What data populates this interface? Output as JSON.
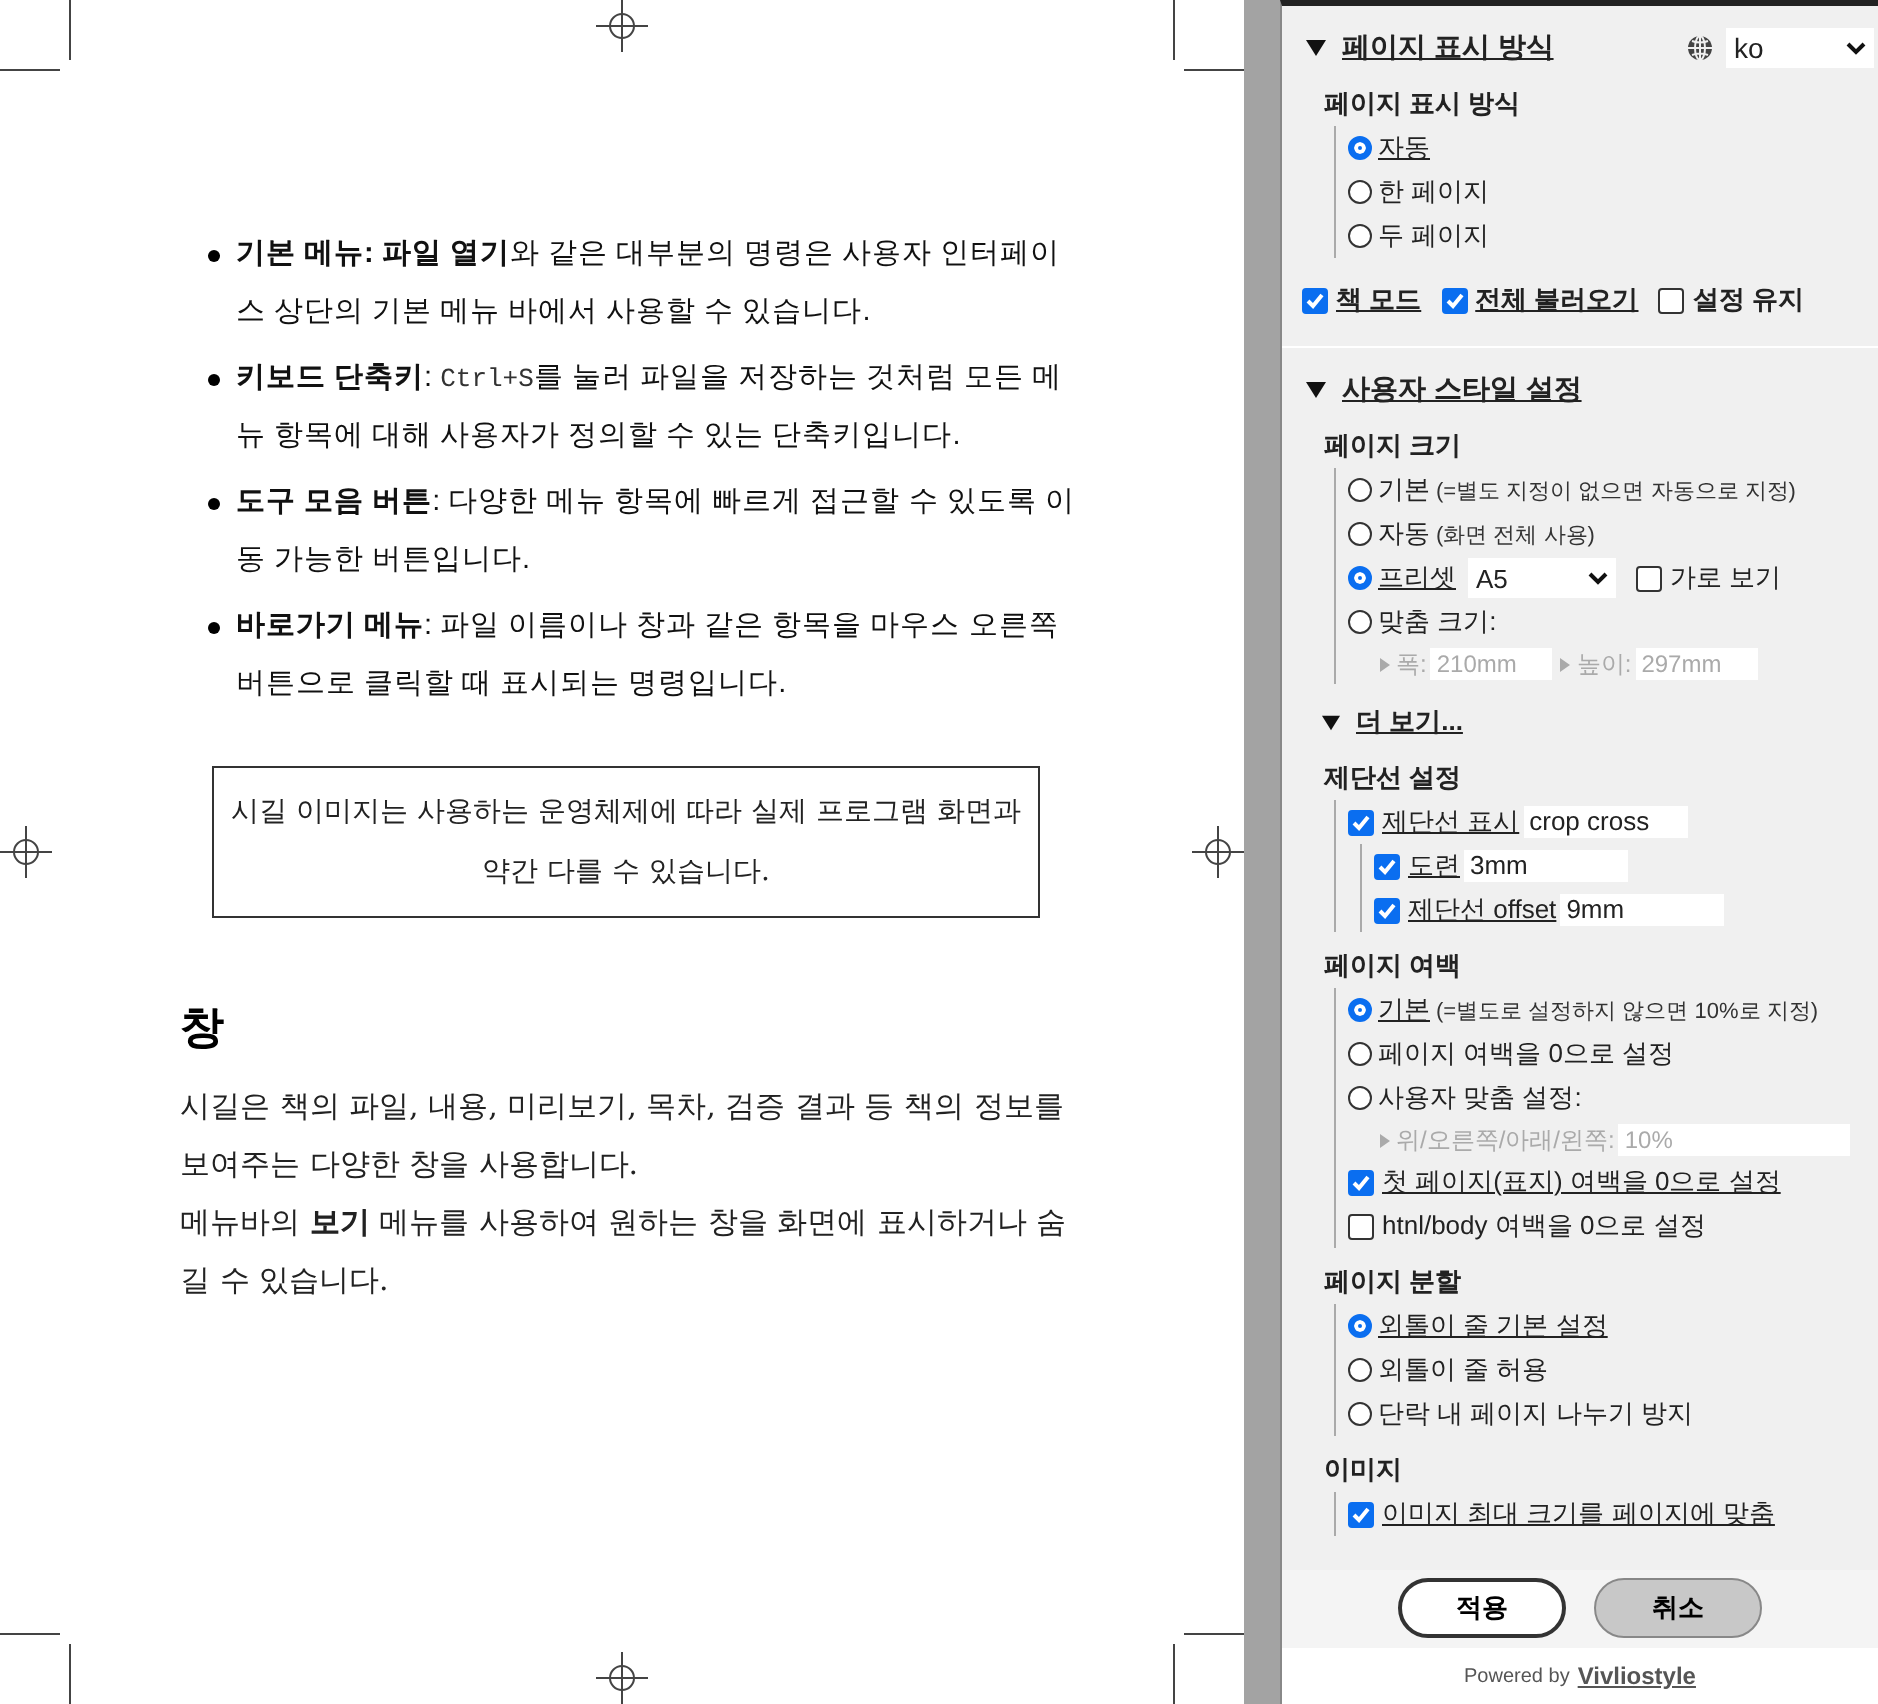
{
  "document": {
    "bullets": [
      {
        "segments": [
          {
            "kind": "bold",
            "text": "기본 메뉴: 파일  열기"
          },
          {
            "kind": "plain",
            "text": "와 같은 대부분의 명령은 사용자 인터페이스 상단의 기본 메뉴 바에서 사용할 수 있습니다."
          }
        ]
      },
      {
        "segments": [
          {
            "kind": "bold",
            "text": "키보드 단축키"
          },
          {
            "kind": "plain",
            "text": ": "
          },
          {
            "kind": "code",
            "text": "Ctrl+S"
          },
          {
            "kind": "plain",
            "text": "를 눌러 파일을 저장하는 것처럼 모든 메뉴 항목에 대해 사용자가 정의할 수 있는 단축키입니다."
          }
        ]
      },
      {
        "segments": [
          {
            "kind": "bold",
            "text": "도구 모음 버튼"
          },
          {
            "kind": "plain",
            "text": ": 다양한 메뉴 항목에 빠르게 접근할 수 있도록 이동 가능한 버튼입니다."
          }
        ]
      },
      {
        "segments": [
          {
            "kind": "bold",
            "text": "바로가기 메뉴"
          },
          {
            "kind": "plain",
            "text": ": 파일 이름이나 창과 같은 항목을 마우스 오른쪽 버튼으로 클릭할 때 표시되는 명령입니다."
          }
        ]
      }
    ],
    "note": "시길 이미지는 사용하는 운영체제에 따라 실제 프로그램 화면과 약간 다를 수 있습니다.",
    "heading": "창",
    "paragraphs": [
      "시길은 책의 파일, 내용, 미리보기, 목차, 검증 결과 등 책의 정보를 보여주는 다양한 창을 사용합니다.",
      "메뉴바의 **보기** 메뉴를 사용하여 원하는 창을 화면에 표시하거나 숨길 수 있습니다."
    ]
  },
  "sidebar": {
    "sections": [
      {
        "title": "페이지 표시 방식",
        "expanded": true,
        "language": "ko",
        "groups": [
          {
            "title": "페이지 표시 방식",
            "items": [
              {
                "kind": "radio",
                "label": "자동",
                "selected": true
              },
              {
                "kind": "radio",
                "label": "한 페이지",
                "selected": false
              },
              {
                "kind": "radio",
                "label": "두 페이지",
                "selected": false
              }
            ]
          }
        ],
        "options_row": [
          {
            "label": "책 모드",
            "checked": true
          },
          {
            "label": "전체 불러오기",
            "checked": true
          },
          {
            "label": "설정 유지",
            "checked": false
          }
        ]
      },
      {
        "title": "사용자 스타일 설정",
        "expanded": true,
        "groups": [
          {
            "title": "페이지 크기",
            "items": [
              {
                "kind": "radio",
                "label": "기본",
                "hint": "(=별도 지정이 없으면 자동으로 지정)",
                "selected": false
              },
              {
                "kind": "radio",
                "label": "자동",
                "hint": "(화면 전체 사용)",
                "selected": false
              },
              {
                "kind": "radio",
                "label": "프리셋",
                "selected": true,
                "select": "A5",
                "extra": {
                  "label": "가로 보기",
                  "checked": false
                }
              },
              {
                "kind": "radio",
                "label": "맞춤 크기:",
                "selected": false,
                "fields": [
                  {
                    "label": "폭:",
                    "placeholder": "210mm",
                    "disabled": true
                  },
                  {
                    "label": "높이:",
                    "placeholder": "297mm",
                    "disabled": true
                  }
                ]
              }
            ]
          }
        ],
        "more": {
          "title": "더 보기...",
          "expanded": true,
          "groups": [
            {
              "title": "제단선 설정",
              "items": [
                {
                  "kind": "checkbox",
                  "label": "제단선 표시",
                  "checked": true,
                  "value": "crop cross",
                  "children": [
                    {
                      "kind": "checkbox",
                      "label": "도련",
                      "checked": true,
                      "value": "3mm"
                    },
                    {
                      "kind": "checkbox",
                      "label": "제단선 offset",
                      "checked": true,
                      "value": "9mm"
                    }
                  ]
                }
              ]
            },
            {
              "title": "페이지 여백",
              "items": [
                {
                  "kind": "radio",
                  "label": "기본",
                  "hint": "(=별도로 설정하지 않으면 10%로 지정)",
                  "selected": true
                },
                {
                  "kind": "radio",
                  "label": "페이지 여백을 0으로 설정",
                  "selected": false
                },
                {
                  "kind": "radio",
                  "label": "사용자 맞춤 설정:",
                  "selected": false,
                  "fields": [
                    {
                      "label": "위/오른쪽/아래/왼쪽:",
                      "placeholder": "10%",
                      "disabled": true
                    }
                  ]
                },
                {
                  "kind": "checkbox",
                  "label": "첫 페이지(표지) 여백을 0으로 설정",
                  "checked": true
                },
                {
                  "kind": "checkbox",
                  "label": "htnl/body 여백을 0으로 설정",
                  "checked": false
                }
              ]
            },
            {
              "title": "페이지 분할",
              "items": [
                {
                  "kind": "radio",
                  "label": "외톨이 줄 기본 설정",
                  "selected": true
                },
                {
                  "kind": "radio",
                  "label": "외톨이 줄 허용",
                  "selected": false
                },
                {
                  "kind": "radio",
                  "label": "단락 내 페이지 나누기 방지",
                  "selected": false
                }
              ]
            },
            {
              "title": "이미지",
              "items": [
                {
                  "kind": "checkbox",
                  "label": "이미지 최대 크기를 페이지에 맞춤",
                  "checked": true
                }
              ]
            }
          ]
        }
      }
    ],
    "buttons": [
      {
        "label": "적용",
        "kind": "primary"
      },
      {
        "label": "취소",
        "kind": "secondary"
      }
    ],
    "powered_by": {
      "text": "Powered by",
      "brand": "Vivliostyle"
    }
  }
}
